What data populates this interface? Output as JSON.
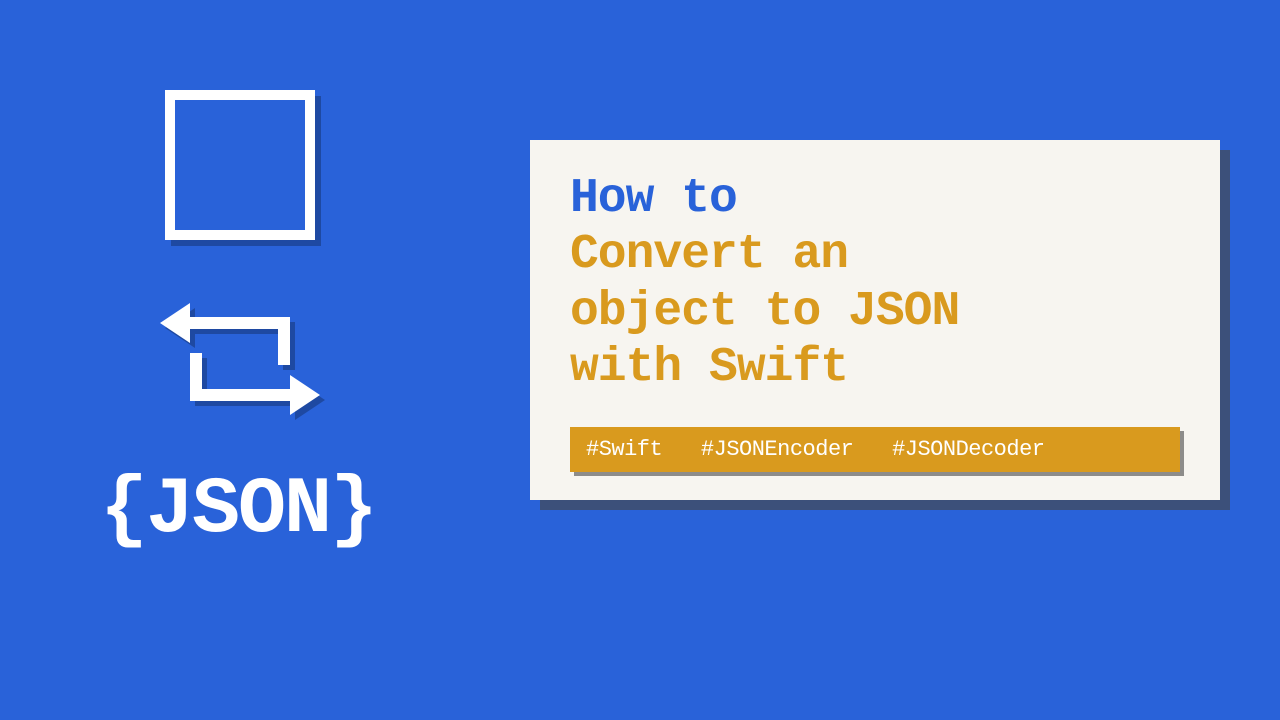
{
  "left": {
    "json_text": "{JSON}"
  },
  "card": {
    "howto": "How to",
    "body": "Convert an\nobject to JSON\nwith Swift",
    "tags": [
      "#Swift",
      "#JSONEncoder",
      "#JSONDecoder"
    ]
  }
}
